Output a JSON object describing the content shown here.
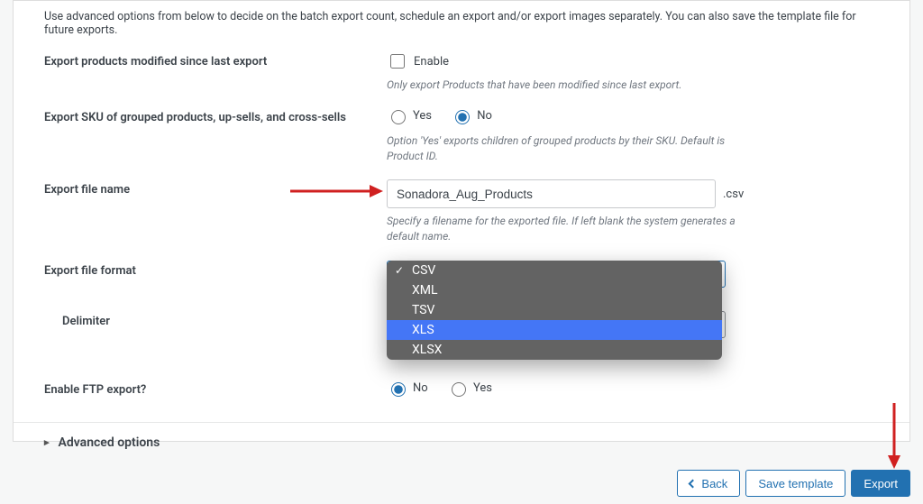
{
  "intro": "Use advanced options from below to decide on the batch export count, schedule an export and/or export images separately. You can also save the template file for future exports.",
  "rows": {
    "modified": {
      "label": "Export products modified since last export",
      "checkbox_label": "Enable",
      "help": "Only export Products that have been modified since last export."
    },
    "sku_grouped": {
      "label": "Export SKU of grouped products, up-sells, and cross-sells",
      "yes": "Yes",
      "no": "No",
      "help": "Option 'Yes' exports children of grouped products by their SKU. Default is Product ID."
    },
    "filename": {
      "label": "Export file name",
      "value": "Sonadora_Aug_Products",
      "ext": ".csv",
      "help": "Specify a filename for the exported file. If left blank the system generates a default name."
    },
    "format": {
      "label": "Export file format",
      "options": [
        "CSV",
        "XML",
        "TSV",
        "XLS",
        "XLSX"
      ],
      "selected": "CSV",
      "highlighted": "XLS"
    },
    "delimiter": {
      "label": "Delimiter"
    },
    "ftp": {
      "label": "Enable FTP export?",
      "no": "No",
      "yes": "Yes"
    }
  },
  "advanced_label": "Advanced options",
  "buttons": {
    "back": "Back",
    "save_template": "Save template",
    "export": "Export"
  }
}
